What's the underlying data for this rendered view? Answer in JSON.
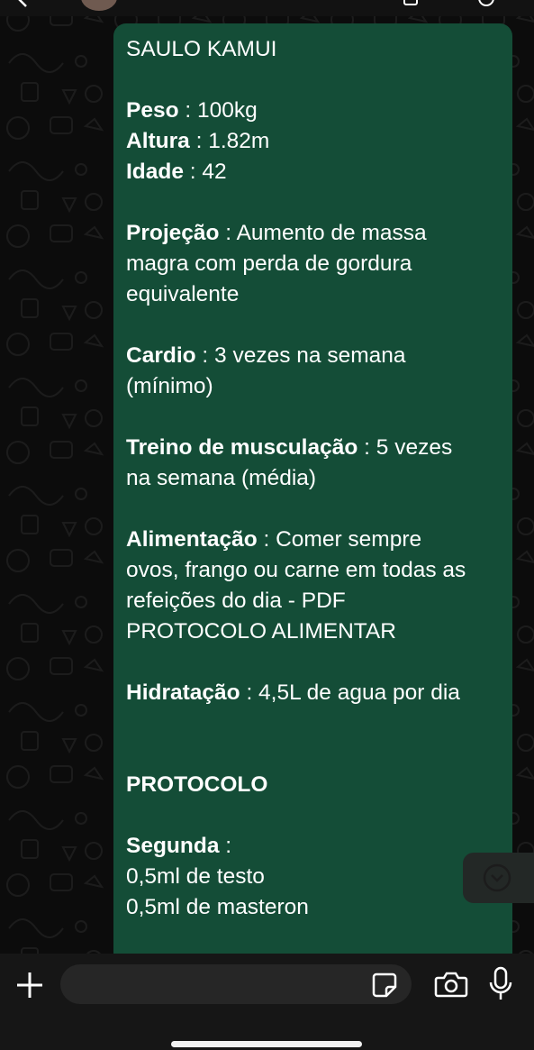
{
  "message": {
    "title": "SAULO KAMUI",
    "weight_label": "Peso",
    "weight_value": " : 100kg",
    "height_label": "Altura",
    "height_value": " : 1.82m",
    "age_label": "Idade",
    "age_value": " : 42",
    "projection_label": "Projeção",
    "projection_line1": " : Aumento de massa",
    "projection_line2": "magra com perda de gordura",
    "projection_line3": "equivalente",
    "cardio_label": "Cardio",
    "cardio_line1": " : 3 vezes na semana",
    "cardio_line2": "(mínimo)",
    "training_label": "Treino de musculação",
    "training_line1": " : 5 vezes",
    "training_line2": "na semana (média)",
    "food_label": "Alimentação",
    "food_line1": " : Comer sempre",
    "food_line2": "ovos, frango ou carne em todas as",
    "food_line3": "refeições do dia - PDF",
    "food_line4": "PROTOCOLO ALIMENTAR",
    "hydration_label": "Hidratação",
    "hydration_value": " : 4,5L de agua por dia",
    "protocol_heading": "PROTOCOLO",
    "monday_label": "Segunda",
    "monday_suffix": " :",
    "monday_item1": "0,5ml de testo",
    "monday_item2": "0,5ml de masteron"
  },
  "composer": {
    "input_value": "",
    "input_placeholder": ""
  },
  "icons": {
    "back": "chevron-left-icon",
    "scroll_down": "chevron-down-circle-icon",
    "plus": "plus-icon",
    "sticker": "sticker-icon",
    "camera": "camera-icon",
    "mic": "microphone-icon"
  },
  "colors": {
    "bubble": "#144d37",
    "background": "#0c0c0c",
    "composer": "#161616",
    "input": "#262626"
  }
}
